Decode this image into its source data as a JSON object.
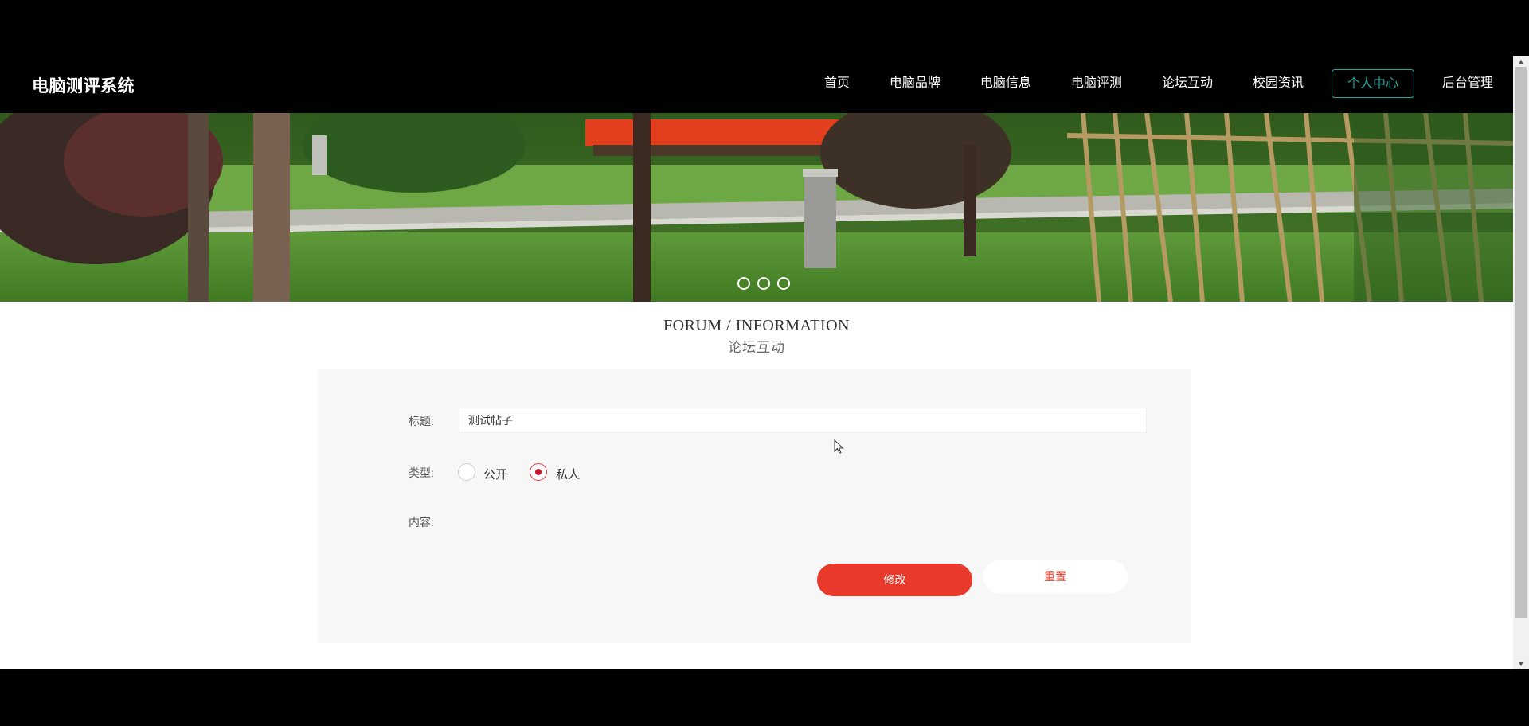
{
  "header": {
    "brand": "电脑测评系统",
    "nav": [
      {
        "label": "首页"
      },
      {
        "label": "电脑品牌"
      },
      {
        "label": "电脑信息"
      },
      {
        "label": "电脑评测"
      },
      {
        "label": "论坛互动"
      },
      {
        "label": "校园资讯"
      },
      {
        "label": "个人中心",
        "active": true
      },
      {
        "label": "后台管理"
      }
    ]
  },
  "banner": {
    "slides": 3
  },
  "section": {
    "title_en": "FORUM / INFORMATION",
    "title_cn": "论坛互动"
  },
  "form": {
    "title_label": "标题:",
    "title_value": "测试帖子",
    "type_label": "类型:",
    "type_options": [
      {
        "label": "公开",
        "checked": false
      },
      {
        "label": "私人",
        "checked": true
      }
    ],
    "content_label": "内容:",
    "save_button": "修改",
    "reset_button": "重置"
  },
  "colors": {
    "accent": "#e8392a",
    "nav_active": "#24a89c",
    "header_bg": "#000000",
    "panel_bg": "#f7f7f7"
  }
}
